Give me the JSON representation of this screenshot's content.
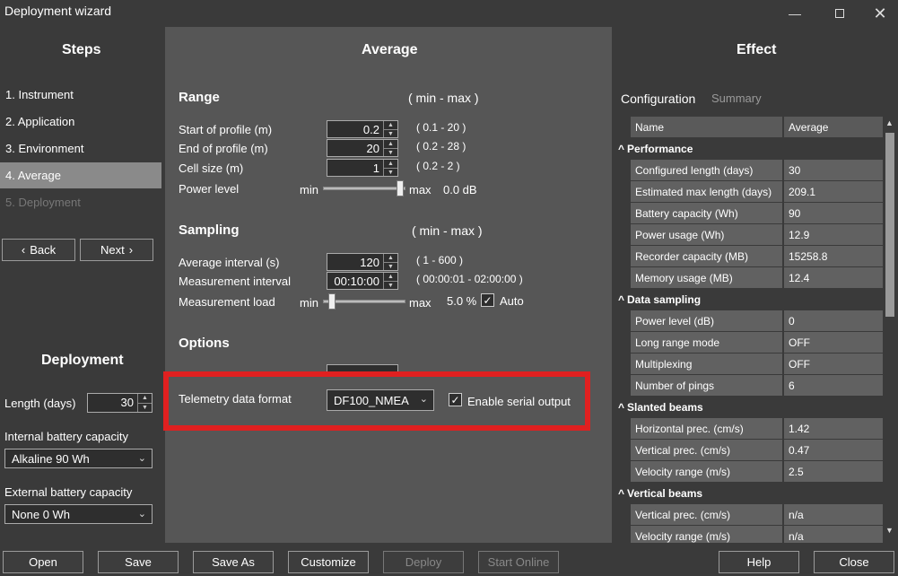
{
  "window": {
    "title": "Deployment wizard",
    "min_icon": "minimize-icon",
    "max_icon": "maximize-icon",
    "close_icon": "close-icon"
  },
  "steps": {
    "heading": "Steps",
    "items": [
      "1.  Instrument",
      "2.  Application",
      "3.  Environment",
      "4.  Average",
      "5.  Deployment"
    ],
    "back": "Back",
    "next": "Next"
  },
  "deployment": {
    "heading": "Deployment",
    "length_label": "Length (days)",
    "length_value": "30",
    "internal_label": "Internal battery capacity",
    "internal_value": "Alkaline 90 Wh",
    "external_label": "External battery capacity",
    "external_value": "None 0 Wh"
  },
  "average": {
    "heading": "Average",
    "range": {
      "title": "Range",
      "minmax": "( min - max )",
      "start_label": "Start of profile (m)",
      "start_value": "0.2",
      "start_range": "( 0.1 - 20 )",
      "end_label": "End of profile (m)",
      "end_value": "20",
      "end_range": "( 0.2 - 28 )",
      "cell_label": "Cell size (m)",
      "cell_value": "1",
      "cell_range": "( 0.2 - 2 )",
      "power_label": "Power level",
      "min": "min",
      "max": "max",
      "power_value": "0.0 dB",
      "power_level": 1.0
    },
    "sampling": {
      "title": "Sampling",
      "minmax": "( min - max )",
      "avg_label": "Average interval (s)",
      "avg_value": "120",
      "avg_range": "( 1 - 600 )",
      "meas_label": "Measurement interval",
      "meas_value": "00:10:00",
      "meas_range": "( 00:00:01 - 02:00:00 )",
      "load_label": "Measurement load",
      "min": "min",
      "max": "max",
      "load_value": "5.0 %",
      "load_level": 0.05,
      "auto_label": "Auto"
    },
    "options": {
      "title": "Options",
      "telemetry_label": "Telemetry data format",
      "telemetry_value": "DF100_NMEA",
      "serial_label": "Enable serial output"
    }
  },
  "effect": {
    "heading": "Effect",
    "tabs": [
      "Configuration",
      "Summary"
    ],
    "col_name": "Name",
    "col_value": "Average",
    "groups": [
      {
        "title": "Performance",
        "rows": [
          [
            "Configured length (days)",
            "30"
          ],
          [
            "Estimated max length (days)",
            "209.1"
          ],
          [
            "Battery capacity (Wh)",
            "90"
          ],
          [
            "Power usage (Wh)",
            "12.9"
          ],
          [
            "Recorder capacity (MB)",
            "15258.8"
          ],
          [
            "Memory usage (MB)",
            "12.4"
          ]
        ]
      },
      {
        "title": "Data sampling",
        "rows": [
          [
            "Power level (dB)",
            "0"
          ],
          [
            "Long range mode",
            "OFF"
          ],
          [
            "Multiplexing",
            "OFF"
          ],
          [
            "Number of pings",
            "6"
          ]
        ]
      },
      {
        "title": "Slanted beams",
        "rows": [
          [
            "Horizontal prec. (cm/s)",
            "1.42"
          ],
          [
            "Vertical prec. (cm/s)",
            "0.47"
          ],
          [
            "Velocity range (m/s)",
            "2.5"
          ]
        ]
      },
      {
        "title": "Vertical beams",
        "rows": [
          [
            "Vertical prec. (cm/s)",
            "n/a"
          ],
          [
            "Velocity range (m/s)",
            "n/a"
          ]
        ]
      }
    ]
  },
  "footer": {
    "open": "Open",
    "save": "Save",
    "save_as": "Save As",
    "customize": "Customize",
    "deploy": "Deploy",
    "start_online": "Start Online",
    "help": "Help",
    "close": "Close"
  }
}
